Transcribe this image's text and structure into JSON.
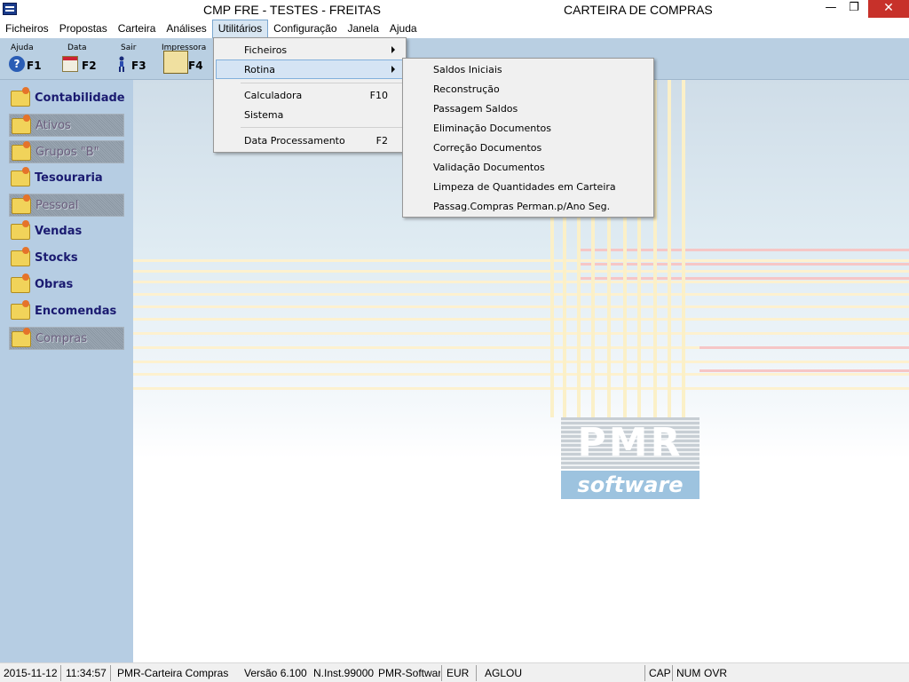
{
  "window": {
    "title_left": "CMP FRE - TESTES - FREITAS",
    "title_right": "CARTEIRA DE COMPRAS",
    "minimize_glyph": "—",
    "restore_glyph": "❐",
    "close_glyph": "✕"
  },
  "menubar": [
    {
      "label": "Ficheiros"
    },
    {
      "label": "Propostas"
    },
    {
      "label": "Carteira"
    },
    {
      "label": "Análises"
    },
    {
      "label": "Utilitários",
      "active": true
    },
    {
      "label": "Configuração"
    },
    {
      "label": "Janela"
    },
    {
      "label": "Ajuda"
    }
  ],
  "toolbar": {
    "help": {
      "label": "Ajuda",
      "key": "F1",
      "icon": "help-icon"
    },
    "date": {
      "label": "Data",
      "key": "F2",
      "icon": "calendar-icon"
    },
    "exit": {
      "label": "Sair",
      "key": "F3",
      "icon": "exit-icon"
    },
    "print": {
      "label": "Impressora",
      "key": "F4",
      "icon": "printer-icon"
    }
  },
  "sidebar": [
    {
      "label": "Contabilidade",
      "enabled": true
    },
    {
      "label": "Ativos",
      "enabled": false
    },
    {
      "label": "Grupos \"B\"",
      "enabled": false
    },
    {
      "label": "Tesouraria",
      "enabled": true
    },
    {
      "label": "Pessoal",
      "enabled": false
    },
    {
      "label": "Vendas",
      "enabled": true
    },
    {
      "label": "Stocks",
      "enabled": true
    },
    {
      "label": "Obras",
      "enabled": true
    },
    {
      "label": "Encomendas",
      "enabled": true
    },
    {
      "label": "Compras",
      "enabled": false
    }
  ],
  "menu_utilitarios": {
    "items": [
      {
        "label": "Ficheiros",
        "submenu": true
      },
      {
        "label": "Rotina",
        "submenu": true,
        "highlighted": true
      },
      {
        "label": "Calculadora",
        "shortcut": "F10"
      },
      {
        "label": "Sistema"
      },
      {
        "label": "Data Processamento",
        "shortcut": "F2"
      }
    ]
  },
  "menu_rotina": {
    "items": [
      {
        "label": "Saldos Iniciais"
      },
      {
        "label": "Reconstrução"
      },
      {
        "label": "Passagem Saldos"
      },
      {
        "label": "Eliminação Documentos"
      },
      {
        "label": "Correção Documentos"
      },
      {
        "label": "Validação Documentos"
      },
      {
        "label": "Limpeza de Quantidades em Carteira"
      },
      {
        "label": "Passag.Compras Perman.p/Ano Seg."
      }
    ]
  },
  "logo": {
    "top": "PMR",
    "bottom": "software"
  },
  "statusbar": {
    "date": "2015-11-12",
    "time": "11:34:57",
    "module": "PMR-Carteira Compras",
    "version": "Versão  6.100",
    "install": "N.Inst.99000",
    "company": "PMR-Softwar",
    "currency": "EUR",
    "user": "AGLOU",
    "cap": "CAP",
    "num": "NUM",
    "ovr": "OVR"
  }
}
